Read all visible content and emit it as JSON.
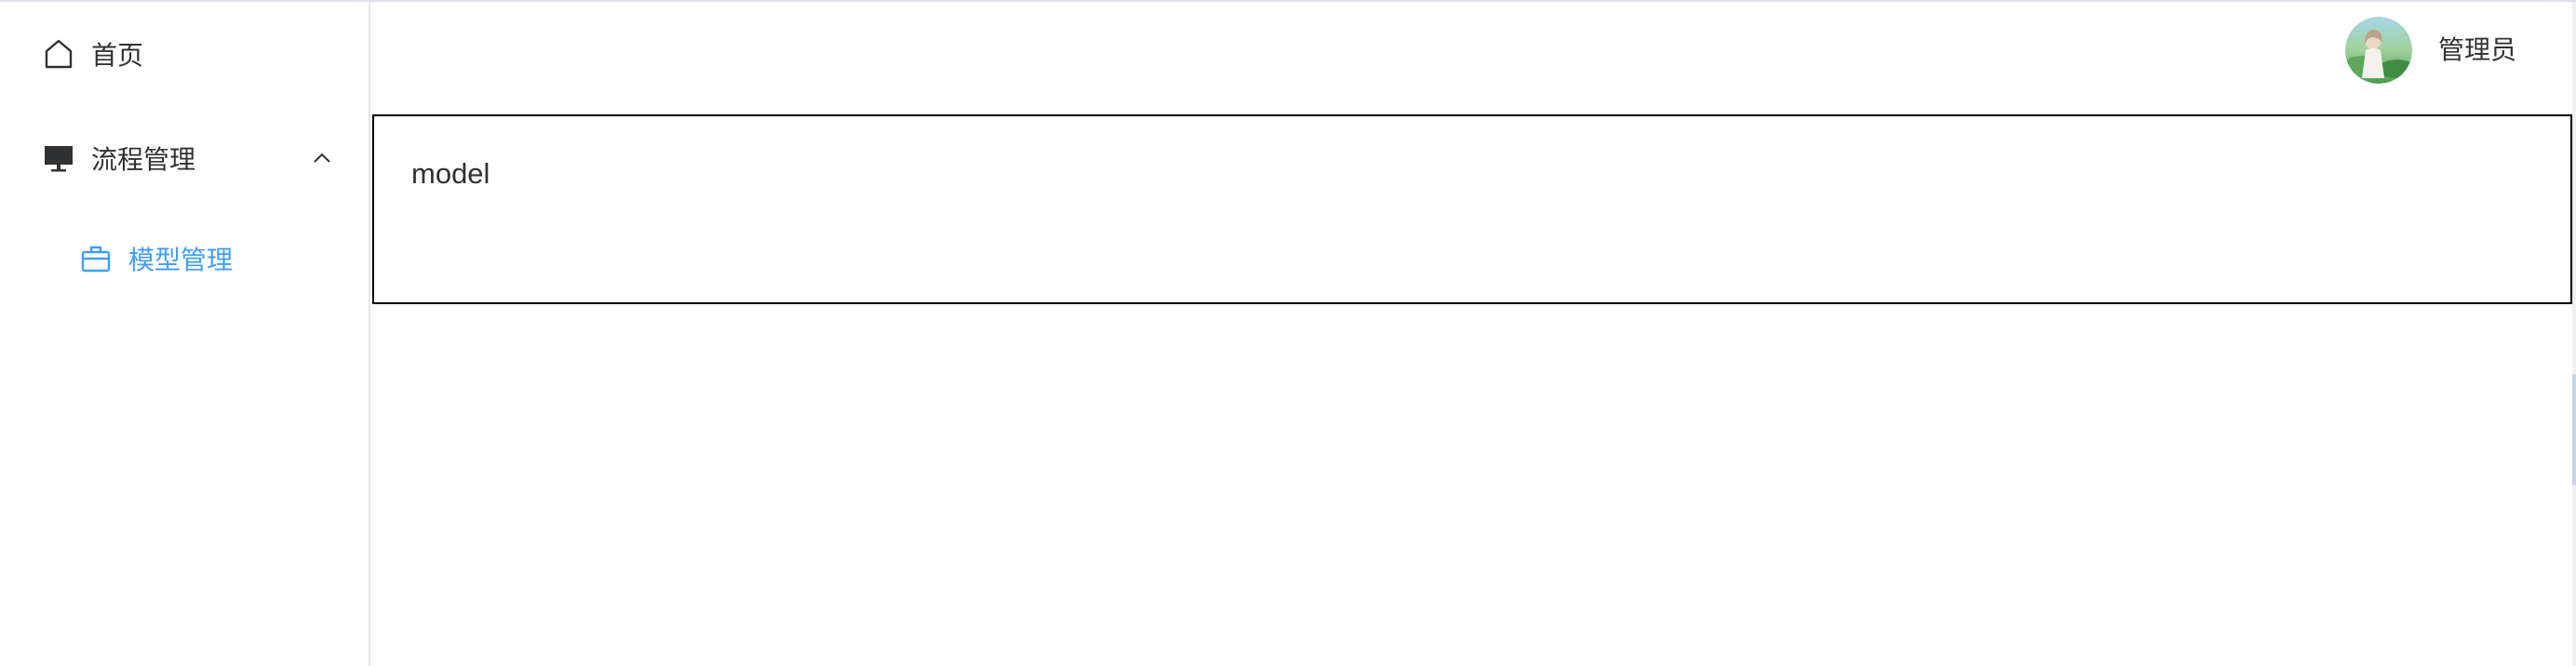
{
  "sidebar": {
    "items": [
      {
        "label": "首页",
        "icon": "home-icon"
      },
      {
        "label": "流程管理",
        "icon": "monitor-icon",
        "expanded": true,
        "children": [
          {
            "label": "模型管理",
            "icon": "briefcase-icon",
            "active": true
          }
        ]
      }
    ]
  },
  "header": {
    "user_name": "管理员",
    "avatar_icon": "avatar-image"
  },
  "main": {
    "title": "model"
  },
  "colors": {
    "active": "#409eff",
    "text": "#303133",
    "border": "#000000"
  }
}
